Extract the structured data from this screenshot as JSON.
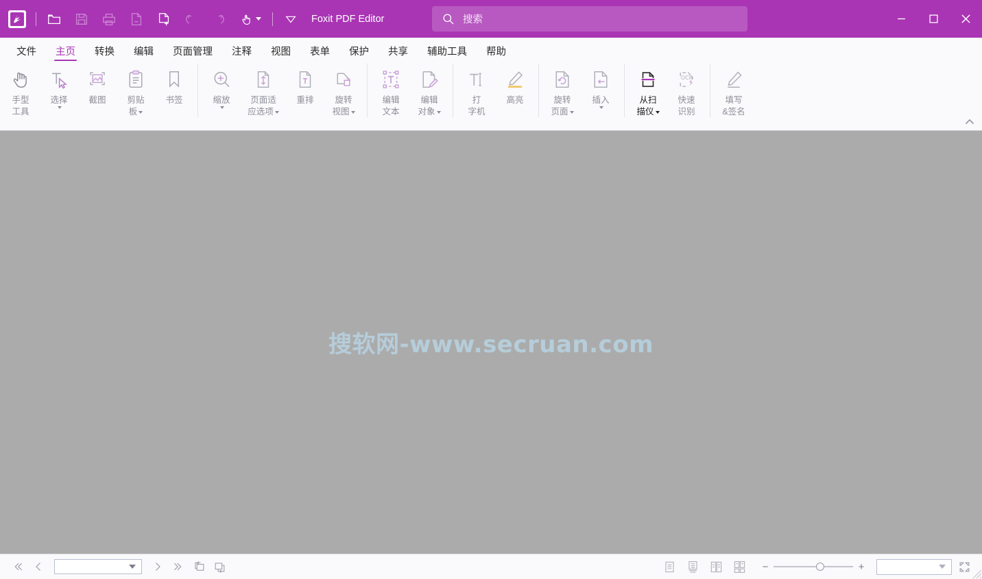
{
  "window": {
    "app_title": "Foxit PDF Editor",
    "accent_color": "#a935b4",
    "doc_background": "#ababab",
    "chrome_background": "#fafafc",
    "controls": {
      "minimize": "minimize",
      "maximize": "maximize",
      "close": "close"
    }
  },
  "quick_access": {
    "items": [
      {
        "name": "app-logo",
        "icon": "foxit-logo-icon"
      },
      {
        "name": "open-file",
        "icon": "folder-open-icon"
      },
      {
        "name": "save",
        "icon": "save-disk-icon"
      },
      {
        "name": "print",
        "icon": "printer-icon"
      },
      {
        "name": "email",
        "icon": "document-minus-icon"
      },
      {
        "name": "create-pdf",
        "icon": "document-plus-icon"
      },
      {
        "name": "undo",
        "icon": "undo-arrow-icon"
      },
      {
        "name": "redo",
        "icon": "redo-arrow-icon"
      },
      {
        "name": "touch-mode",
        "icon": "hand-touch-icon"
      },
      {
        "name": "customize-quick-access",
        "icon": "chevron-down-outline-icon"
      }
    ]
  },
  "search": {
    "placeholder": "搜索",
    "icon": "search-icon"
  },
  "menu": {
    "tabs": [
      {
        "label": "文件",
        "active": false
      },
      {
        "label": "主页",
        "active": true
      },
      {
        "label": "转换",
        "active": false
      },
      {
        "label": "编辑",
        "active": false
      },
      {
        "label": "页面管理",
        "active": false
      },
      {
        "label": "注释",
        "active": false
      },
      {
        "label": "视图",
        "active": false
      },
      {
        "label": "表单",
        "active": false
      },
      {
        "label": "保护",
        "active": false
      },
      {
        "label": "共享",
        "active": false
      },
      {
        "label": "辅助工具",
        "active": false
      },
      {
        "label": "帮助",
        "active": false
      }
    ]
  },
  "ribbon": {
    "collapse_icon": "chevron-up-icon",
    "groups": [
      {
        "name": "tools",
        "items": [
          {
            "label": "手型\n工具",
            "line1": "手型",
            "line2": "工具",
            "icon": "hand-tool-icon",
            "dropdown": false,
            "active": false
          },
          {
            "label": "选择",
            "line1": "选择",
            "line2": "",
            "icon": "select-text-icon",
            "dropdown": true,
            "active": false
          },
          {
            "label": "截图",
            "line1": "截图",
            "line2": "",
            "icon": "snapshot-icon",
            "dropdown": false,
            "active": false
          },
          {
            "label": "剪贴板",
            "line1": "剪贴",
            "line2": "板",
            "icon": "clipboard-icon",
            "dropdown": true,
            "active": false
          },
          {
            "label": "书签",
            "line1": "书签",
            "line2": "",
            "icon": "bookmark-icon",
            "dropdown": false,
            "active": false
          }
        ]
      },
      {
        "name": "view",
        "items": [
          {
            "label": "缩放",
            "line1": "缩放",
            "line2": "",
            "icon": "zoom-magnifier-icon",
            "dropdown": true,
            "active": false
          },
          {
            "label": "页面适应选项",
            "line1": "页面适",
            "line2": "应选项",
            "icon": "fit-page-icon",
            "dropdown": true,
            "active": false
          },
          {
            "label": "重排",
            "line1": "重排",
            "line2": "",
            "icon": "reflow-text-icon",
            "dropdown": false,
            "active": false
          },
          {
            "label": "旋转视图",
            "line1": "旋转",
            "line2": "视图",
            "icon": "rotate-view-icon",
            "dropdown": true,
            "active": false
          }
        ]
      },
      {
        "name": "edit",
        "items": [
          {
            "label": "编辑文本",
            "line1": "编辑",
            "line2": "文本",
            "icon": "edit-text-icon",
            "dropdown": false,
            "active": false
          },
          {
            "label": "编辑对象",
            "line1": "编辑",
            "line2": "对象",
            "icon": "edit-object-icon",
            "dropdown": true,
            "active": false
          }
        ]
      },
      {
        "name": "annotate",
        "items": [
          {
            "label": "打字机",
            "line1": "打",
            "line2": "字机",
            "icon": "typewriter-icon",
            "dropdown": false,
            "active": false
          },
          {
            "label": "高亮",
            "line1": "高亮",
            "line2": "",
            "icon": "highlighter-icon",
            "dropdown": false,
            "active": false
          }
        ]
      },
      {
        "name": "pages",
        "items": [
          {
            "label": "旋转页面",
            "line1": "旋转",
            "line2": "页面",
            "icon": "rotate-page-icon",
            "dropdown": true,
            "active": false
          },
          {
            "label": "插入",
            "line1": "插入",
            "line2": "",
            "icon": "insert-page-icon",
            "dropdown": true,
            "active": false
          }
        ]
      },
      {
        "name": "scan-ocr",
        "items": [
          {
            "label": "从扫描仪",
            "line1": "从扫",
            "line2": "描仪",
            "icon": "scanner-icon",
            "dropdown": true,
            "active": true
          },
          {
            "label": "快速识别",
            "line1": "快速",
            "line2": "识别",
            "icon": "ocr-icon",
            "dropdown": false,
            "active": false
          }
        ]
      },
      {
        "name": "forms",
        "items": [
          {
            "label": "填写&签名",
            "line1": "填写",
            "line2": "&签名",
            "icon": "fill-sign-pen-icon",
            "dropdown": false,
            "active": false
          }
        ]
      }
    ]
  },
  "document": {
    "watermark": "搜软网-www.secruan.com",
    "watermark_color": "#b7cfdd"
  },
  "statusbar": {
    "first_page": {
      "name": "first-page",
      "icon": "double-chevron-left-icon"
    },
    "prev_page": {
      "name": "previous-page",
      "icon": "chevron-left-icon"
    },
    "page_input": {
      "value": "",
      "placeholder": ""
    },
    "next_page": {
      "name": "next-page",
      "icon": "chevron-right-icon"
    },
    "last_page": {
      "name": "last-page",
      "icon": "double-chevron-right-icon"
    },
    "prev_view": {
      "name": "previous-view",
      "icon": "back-view-icon"
    },
    "next_view": {
      "name": "next-view",
      "icon": "forward-view-icon"
    },
    "view_modes": [
      {
        "name": "single-page-view",
        "icon": "single-page-icon"
      },
      {
        "name": "continuous-scroll-view",
        "icon": "continuous-page-icon"
      },
      {
        "name": "two-page-view",
        "icon": "two-page-icon"
      },
      {
        "name": "two-page-continuous-view",
        "icon": "two-page-continuous-icon"
      }
    ],
    "zoom_out": "−",
    "zoom_in": "+",
    "zoom_slider_value": 53,
    "zoom_value": "",
    "fullscreen": {
      "name": "fullscreen",
      "icon": "expand-arrows-icon"
    }
  }
}
